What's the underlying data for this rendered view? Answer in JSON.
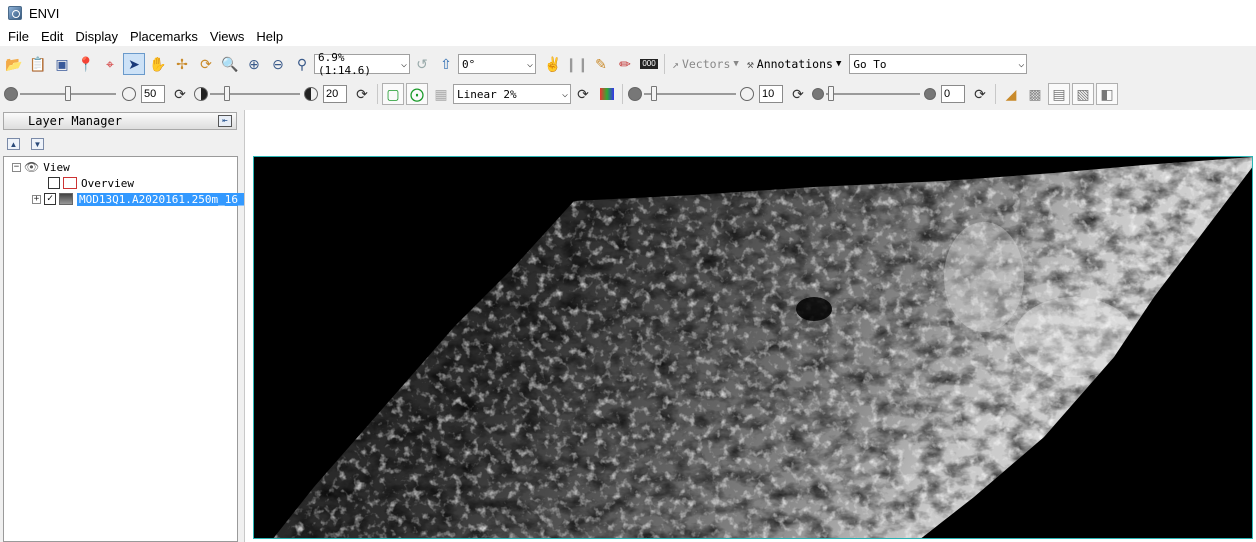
{
  "window": {
    "title": "ENVI"
  },
  "menu": [
    "File",
    "Edit",
    "Display",
    "Placemarks",
    "Views",
    "Help"
  ],
  "toolbar1": {
    "zoom_value": "6.9% (1:14.6)",
    "rotation_value": "0°",
    "vectors_label": "Vectors",
    "annotations_label": "Annotations",
    "goto_value": "Go To"
  },
  "toolbar2": {
    "brightness_value": "50",
    "contrast_value": "20",
    "stretch_value": "Linear 2%",
    "sharpen_value": "10",
    "transparency_value": "0"
  },
  "layer_manager": {
    "title": "Layer Manager",
    "view_label": "View",
    "overview_label": "Overview",
    "layer_label": "MOD13Q1.A2020161.250m_16_"
  }
}
